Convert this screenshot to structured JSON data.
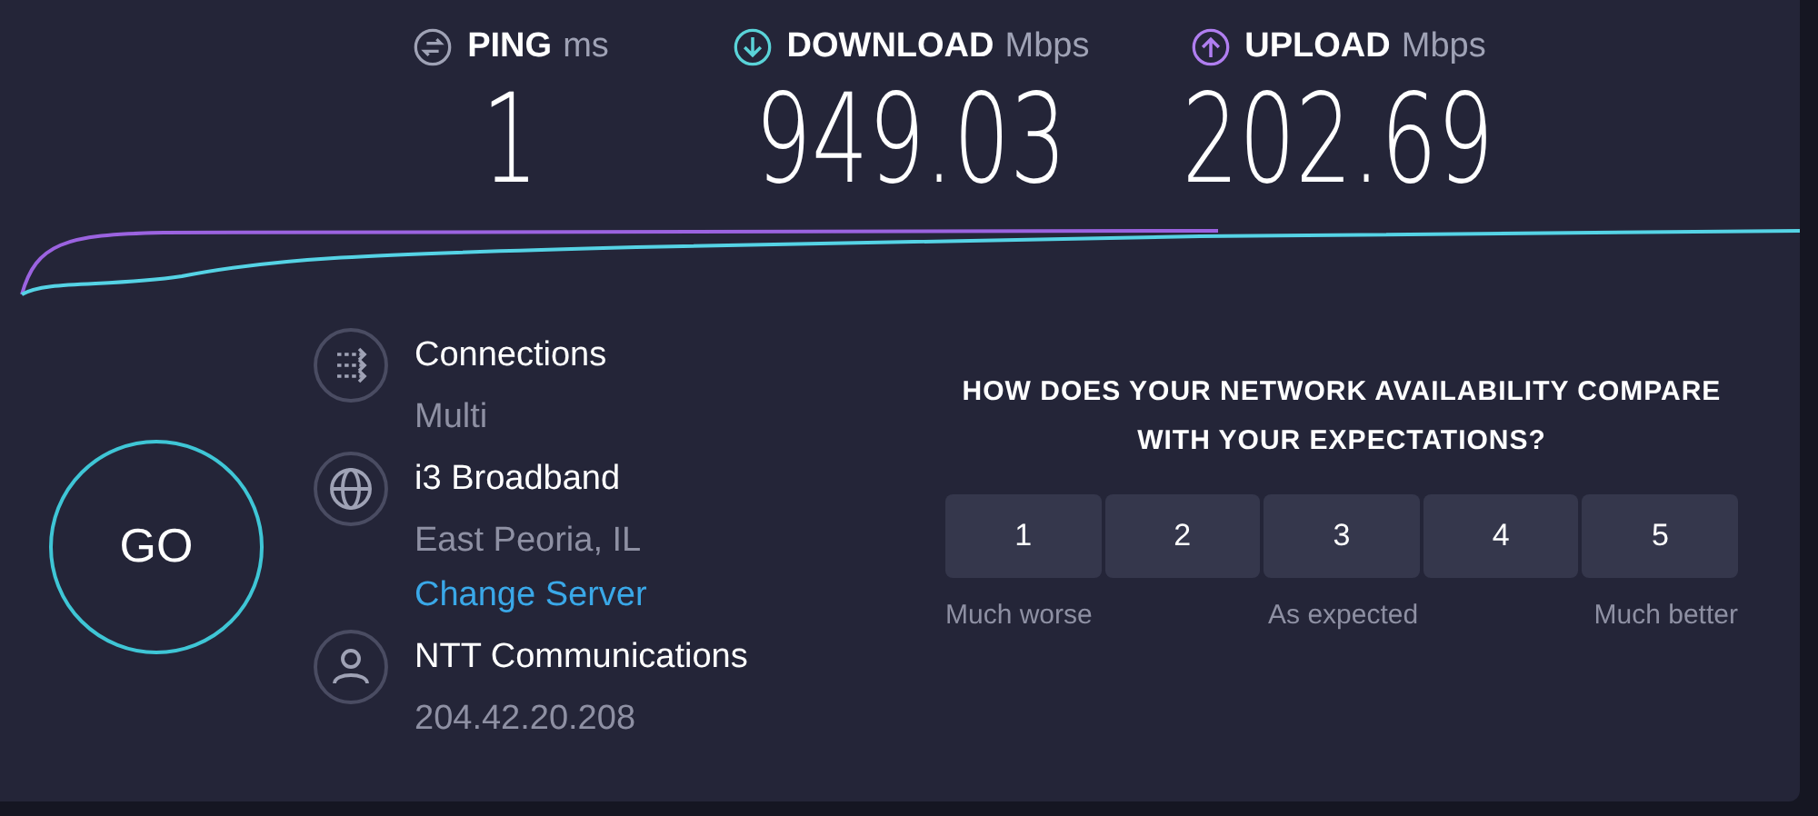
{
  "metrics": [
    {
      "kind": "ping",
      "label": "PING",
      "unit": "ms",
      "value": "1"
    },
    {
      "kind": "download",
      "label": "DOWNLOAD",
      "unit": "Mbps",
      "value": "949.03"
    },
    {
      "kind": "upload",
      "label": "UPLOAD",
      "unit": "Mbps",
      "value": "202.69"
    }
  ],
  "go_button": "GO",
  "info": [
    {
      "kind": "connections",
      "title": "Connections",
      "subtitle": "Multi"
    },
    {
      "kind": "server",
      "title": "i3 Broadband",
      "subtitle": "East Peoria, IL",
      "link": "Change Server"
    },
    {
      "kind": "provider",
      "title": "NTT Communications",
      "subtitle": "204.42.20.208"
    }
  ],
  "survey": {
    "question": "HOW DOES YOUR NETWORK AVAILABILITY COMPARE WITH YOUR EXPECTATIONS?",
    "options": [
      {
        "label": "1",
        "selected": false
      },
      {
        "label": "2",
        "selected": false
      },
      {
        "label": "3",
        "selected": false
      },
      {
        "label": "4",
        "selected": false
      },
      {
        "label": "5",
        "selected": false
      }
    ],
    "scale_labels": [
      "Much worse",
      "As expected",
      "Much better"
    ]
  }
}
